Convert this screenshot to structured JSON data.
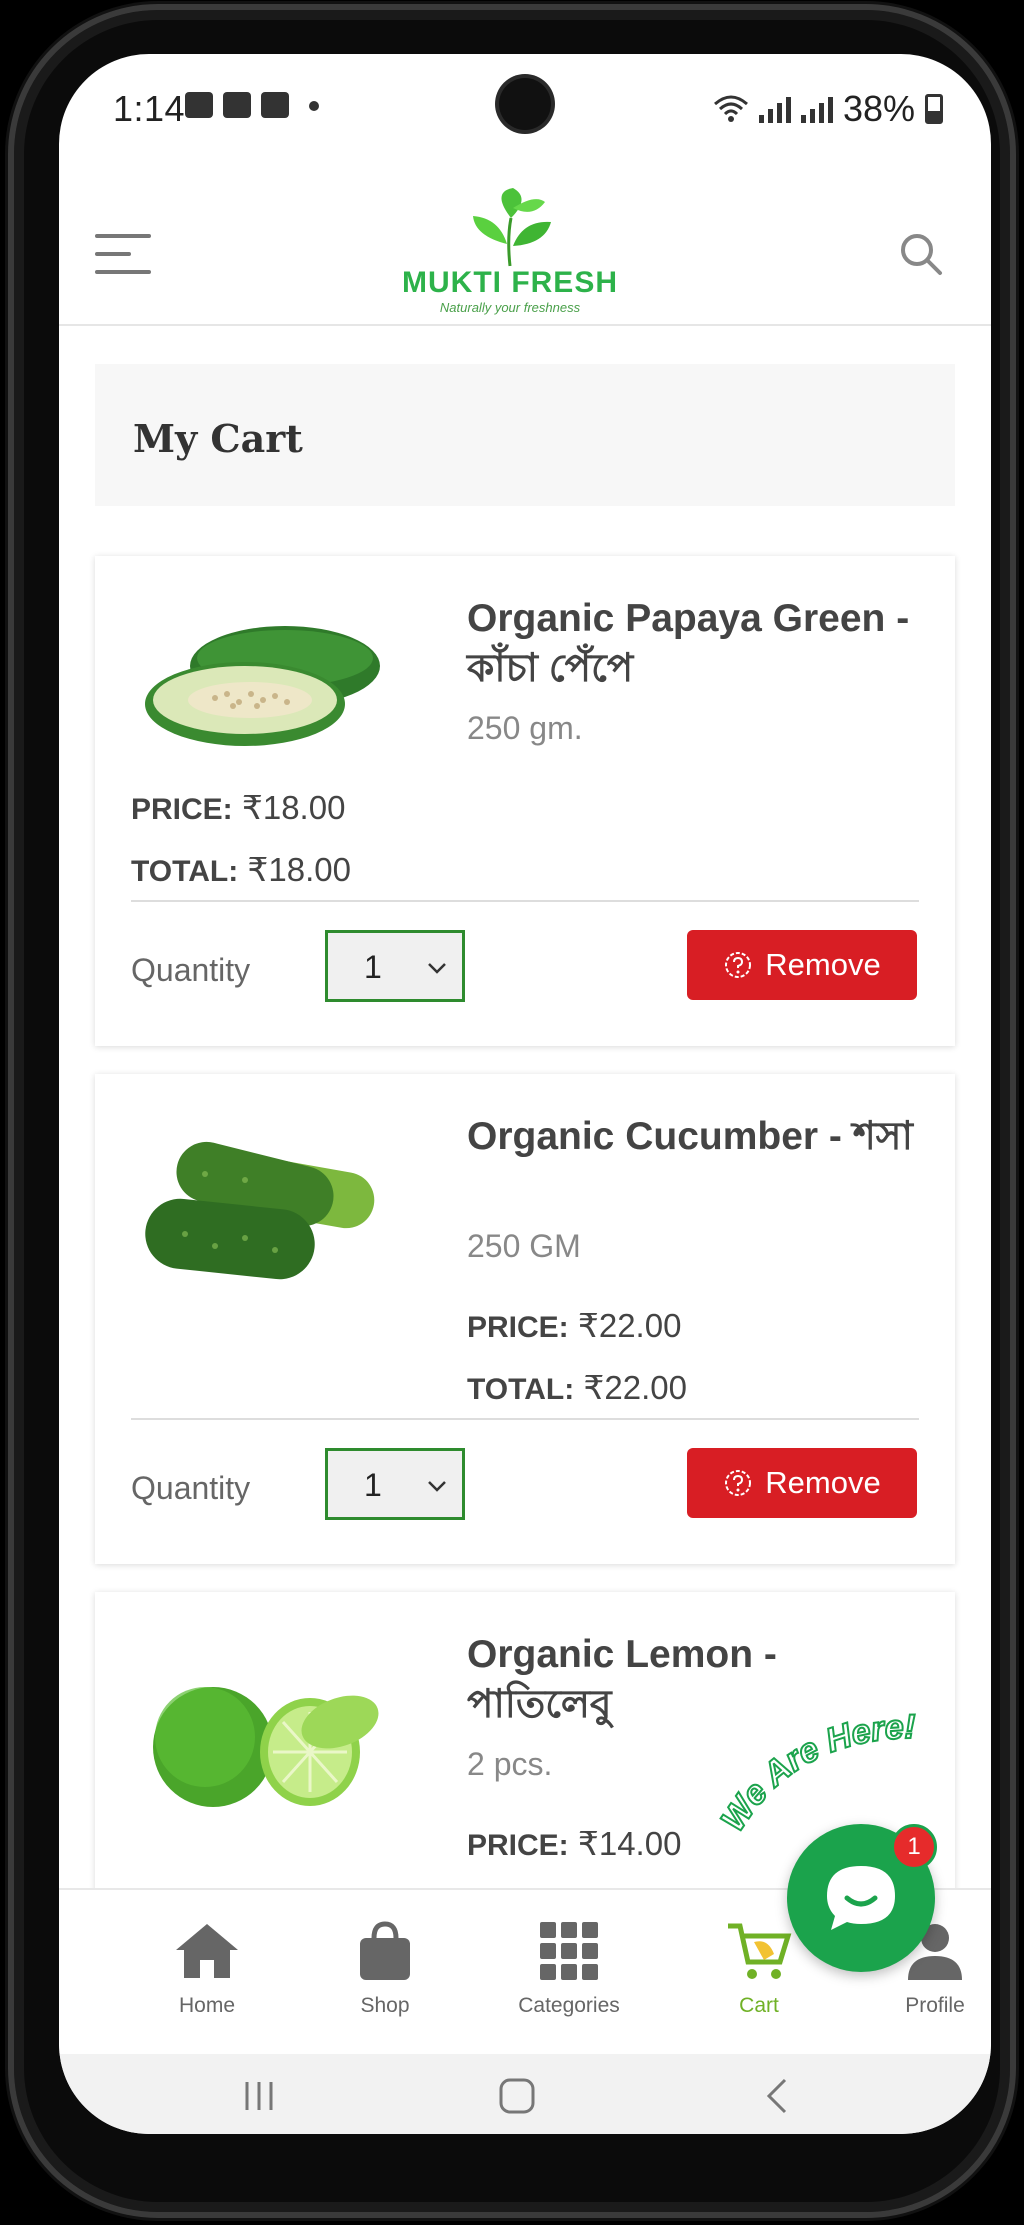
{
  "status_bar": {
    "time": "1:14",
    "battery": "38%"
  },
  "header": {
    "logo_text": "MUKTI FRESH",
    "logo_tagline": "Naturally your freshness"
  },
  "page": {
    "title": "My Cart"
  },
  "labels": {
    "price": "PRICE:",
    "total": "TOTAL:",
    "quantity": "Quantity",
    "remove": "Remove"
  },
  "cart": {
    "items": [
      {
        "name": "Organic Papaya Green - কাঁচা পেঁপে",
        "size": "250 gm.",
        "price": "₹18.00",
        "total": "₹18.00",
        "quantity": "1"
      },
      {
        "name": "Organic Cucumber - শসা",
        "size": "250 GM",
        "price": "₹22.00",
        "total": "₹22.00",
        "quantity": "1"
      },
      {
        "name": "Organic Lemon - পাতিলেবু",
        "size": "2 pcs.",
        "price": "₹14.00"
      }
    ]
  },
  "bottom_nav": {
    "items": [
      {
        "label": "Home"
      },
      {
        "label": "Shop"
      },
      {
        "label": "Categories"
      },
      {
        "label": "Cart"
      },
      {
        "label": "Profile"
      }
    ]
  },
  "chat": {
    "badge_count": "1",
    "callout": "We Are Here!"
  },
  "colors": {
    "accent_green": "#70b126",
    "remove_red": "#d81e24",
    "chat_green": "#1ba34c"
  }
}
